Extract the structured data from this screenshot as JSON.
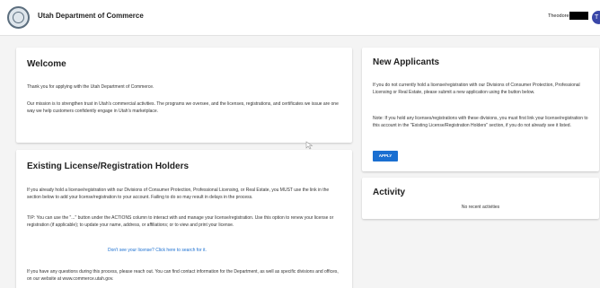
{
  "header": {
    "title": "Utah Department of Commerce",
    "user_name": "Theodore",
    "avatar_initial": "T"
  },
  "welcome": {
    "heading": "Welcome",
    "para1": "Thank you for applying with the Utah Department of Commerce.",
    "para2": "Our mission is to strengthen trust in Utah's commercial activities. The programs we oversee, and the licenses, registrations, and certificates we issue are one way we help customers confidently engage in Utah's marketplace."
  },
  "existing": {
    "heading": "Existing License/Registration Holders",
    "para1": "If you already hold a license/registration with our Divisions of Consumer Protection, Professional Licensing, or Real Estate, you MUST use the link in the section below to add your license/registration to your account. Failing to do so may result in delays in the process.",
    "para2": "TIP: You can use the \"...\" button under the ACTIONS column to interact with and manage your license/registration. Use this option to renew your license or registration (if applicable); to update your name, address, or affiliations; or to view and print your license.",
    "link": "Don't see your license? Click here to search for it.",
    "para3": "If you have any questions during this process, please reach out. You can find contact information for the Department, as well as specific divisions and offices, on our website at www.commerce.utah.gov."
  },
  "new_applicants": {
    "heading": "New Applicants",
    "para1": "If you do not currently hold a license/registration with our Divisions of Consumer Protection, Professional Licensing or Real Estate, please submit a new application using the button below.",
    "para2": "Note: If you hold any licenses/registrations with these divisions, you must first link your license/registration to this account in the \"Existing License/Registration Holders\" section, if you do not already see it listed.",
    "button": "APPLY"
  },
  "activity": {
    "heading": "Activity",
    "empty": "No recent activities"
  }
}
